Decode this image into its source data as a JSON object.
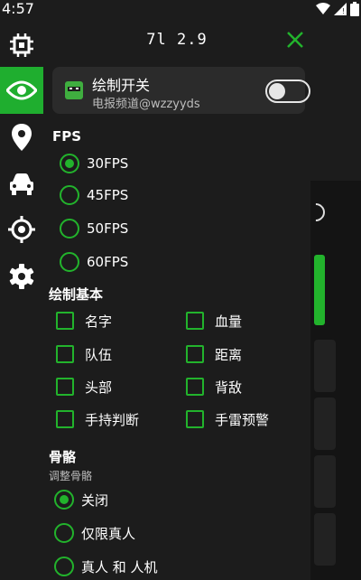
{
  "status_bar": {
    "time": "4:57"
  },
  "colors": {
    "accent": "#22b32c",
    "background": "#1c1c1c",
    "card": "#2b2b2b"
  },
  "sidebar": {
    "items": [
      {
        "icon": "chip-icon",
        "active": false
      },
      {
        "icon": "eye-icon",
        "active": true
      },
      {
        "icon": "map-pin-icon",
        "active": false
      },
      {
        "icon": "car-icon",
        "active": false
      },
      {
        "icon": "crosshair-icon",
        "active": false
      },
      {
        "icon": "gear-icon",
        "active": false
      }
    ]
  },
  "header": {
    "title": "7l 2.9",
    "close_icon": "close-icon"
  },
  "draw_switch": {
    "title": "绘制开关",
    "subtitle": "电报频道@wzzyyds",
    "enabled": false
  },
  "fps": {
    "label": "FPS",
    "options": [
      "30FPS",
      "45FPS",
      "50FPS",
      "60FPS"
    ],
    "selected": "30FPS"
  },
  "draw_basic": {
    "label": "绘制基本",
    "items": [
      "名字",
      "血量",
      "队伍",
      "距离",
      "头部",
      "背敌",
      "手持判断",
      "手雷预警"
    ]
  },
  "skeleton": {
    "label": "骨骼",
    "sublabel": "调整骨骼",
    "options": [
      "关闭",
      "仅限真人",
      "真人 和 人机"
    ],
    "selected": "关闭"
  }
}
